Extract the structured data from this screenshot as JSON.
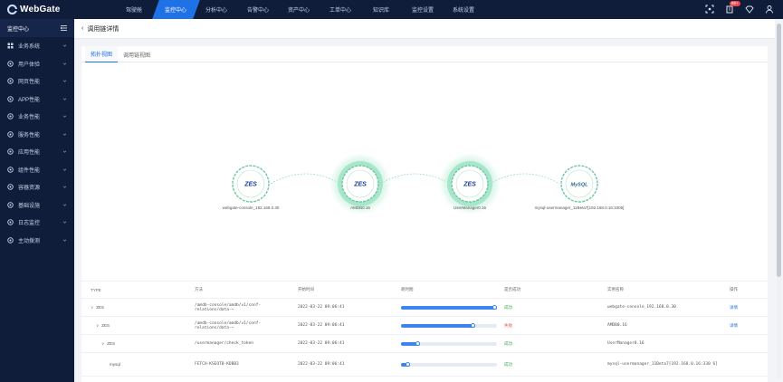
{
  "app": {
    "name": "WebGate"
  },
  "nav": [
    "驾驶舱",
    "监控中心",
    "分析中心",
    "告警中心",
    "资产中心",
    "工单中心",
    "知识库",
    "监控设置",
    "系统设置"
  ],
  "top_icons": {
    "fullscreen_tooltip": "全屏",
    "notice_badge": "99+"
  },
  "sidebar": {
    "title": "监控中心",
    "items": [
      {
        "label": "业务系统",
        "icon": "grid-icon"
      },
      {
        "label": "用户体验",
        "icon": "user-experience-icon"
      },
      {
        "label": "网页性能",
        "icon": "web-icon"
      },
      {
        "label": "APP性能",
        "icon": "app-icon"
      },
      {
        "label": "业务性能",
        "icon": "briefcase-icon"
      },
      {
        "label": "服务性能",
        "icon": "server-icon"
      },
      {
        "label": "应用性能",
        "icon": "app-performance-icon"
      },
      {
        "label": "组件性能",
        "icon": "component-icon"
      },
      {
        "label": "容器资源",
        "icon": "container-icon"
      },
      {
        "label": "基础设施",
        "icon": "infrastructure-icon"
      },
      {
        "label": "日志监控",
        "icon": "log-icon"
      },
      {
        "label": "主动拨测",
        "icon": "probe-icon"
      }
    ]
  },
  "page": {
    "title": "调用链详情"
  },
  "tabs": [
    "拓扑视图",
    "调用链视图"
  ],
  "topology": {
    "nodes": [
      {
        "label": "webgate-console_192.168.0.30",
        "logo": "ZES",
        "halo": false
      },
      {
        "label": "AMDB0.16",
        "logo": "ZES",
        "halo": true
      },
      {
        "label": "UserManager0.16",
        "logo": "ZES",
        "halo": true
      },
      {
        "label": "mysql-usermanager_11Beta7[192.168.0.16:3306]",
        "logo": "MySQL",
        "halo": false
      }
    ]
  },
  "table": {
    "headers": [
      "TYPE",
      "方法",
      "开始时间",
      "耗时图",
      "是否成功",
      "实例名称",
      "操作"
    ],
    "rows": [
      {
        "caret": "∨",
        "type": "ZES",
        "method": "/amdb-console/amdb/v1/conf-relations/data-~",
        "start": "2022-03-22 09:06:41",
        "progress": 1.0,
        "success": "成功",
        "ok": true,
        "instance": "webgate-console_192.168.0.30",
        "op": "详情",
        "indent": 0
      },
      {
        "caret": "∨",
        "type": "ZES",
        "method": "/amdb-console/amdb/v1/conf-relations/data-~",
        "start": "2022-03-22 09:06:41",
        "progress": 0.77,
        "success": "失败",
        "ok": false,
        "instance": "AMDB0.16",
        "op": "详情",
        "indent": 1
      },
      {
        "caret": "∨",
        "type": "ZES",
        "method": "/usermanager/check_token",
        "start": "2022-03-22 09:06:41",
        "progress": 0.2,
        "success": "成功",
        "ok": true,
        "instance": "UserManager0.16",
        "op": "",
        "indent": 2
      },
      {
        "caret": "",
        "type": "mysql",
        "method": "FETCH-KSEOTB-KDBB3",
        "start": "2022-03-22 09:06:41",
        "progress": 0.09,
        "success": "成功",
        "ok": true,
        "instance": "mysql-usermanager_11Beta7[192.168.0.16:330 6]",
        "op": "",
        "indent": 3
      }
    ]
  },
  "colors": {
    "accent": "#1f71e6",
    "sidebar_bg": "#0f1d3b",
    "halo": "#7fd6b0",
    "success": "#3aa65a",
    "fail": "#e0534a"
  }
}
